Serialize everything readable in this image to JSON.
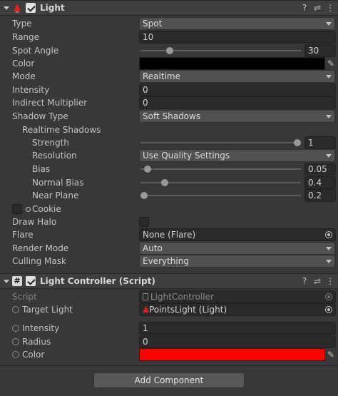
{
  "light": {
    "title": "Light",
    "fields": {
      "type": {
        "label": "Type",
        "value": "Spot"
      },
      "range": {
        "label": "Range",
        "value": "10"
      },
      "spot_angle": {
        "label": "Spot Angle",
        "value": "30",
        "level": 0.167
      },
      "color": {
        "label": "Color",
        "value": "#000000"
      },
      "mode": {
        "label": "Mode",
        "value": "Realtime"
      },
      "intensity": {
        "label": "Intensity",
        "value": "0"
      },
      "indirect": {
        "label": "Indirect Multiplier",
        "value": "0"
      },
      "shadow_type": {
        "label": "Shadow Type",
        "value": "Soft Shadows"
      },
      "realtime_shadows": {
        "label": "Realtime Shadows"
      },
      "strength": {
        "label": "Strength",
        "value": "1",
        "level": 1.0
      },
      "resolution": {
        "label": "Resolution",
        "value": "Use Quality Settings"
      },
      "bias": {
        "label": "Bias",
        "value": "0.05",
        "level": 0.025
      },
      "normal_bias": {
        "label": "Normal Bias",
        "value": "0.4",
        "level": 0.133
      },
      "near_plane": {
        "label": "Near Plane",
        "value": "0.2",
        "level": 0.0
      },
      "cookie": {
        "label": "Cookie"
      },
      "draw_halo": {
        "label": "Draw Halo"
      },
      "flare": {
        "label": "Flare",
        "value": "None (Flare)"
      },
      "render_mode": {
        "label": "Render Mode",
        "value": "Auto"
      },
      "culling_mask": {
        "label": "Culling Mask",
        "value": "Everything"
      }
    }
  },
  "controller": {
    "title": "Light Controller (Script)",
    "script": {
      "label": "Script",
      "value": "LightController"
    },
    "target_light": {
      "label": "Target Light",
      "value": "PointsLight (Light)"
    },
    "intensity": {
      "label": "Intensity",
      "value": "1"
    },
    "radius": {
      "label": "Radius",
      "value": "0"
    },
    "color": {
      "label": "Color",
      "value": "#ff0000"
    }
  },
  "add_component": "Add Component",
  "header_icons": [
    "help-icon",
    "preset-icon",
    "more-icon"
  ]
}
